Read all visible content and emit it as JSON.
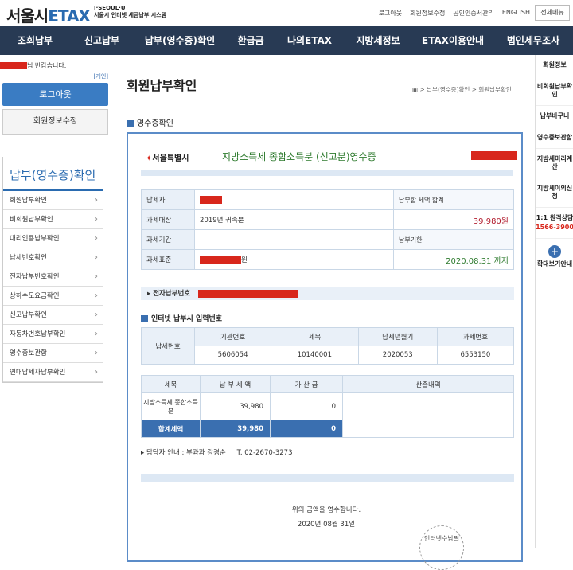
{
  "header": {
    "logo_ko": "서울시",
    "logo_en": "ETAX",
    "logo_sub1": "I·SEOUL·U",
    "logo_sub2": "서울시 인터넷 세금납부 시스템",
    "links": [
      "로그아웃",
      "회원정보수정",
      "공인인증서관리",
      "ENGLISH"
    ],
    "all_menu": "전체메뉴"
  },
  "gnb": [
    "조회납부",
    "신고납부",
    "납부(영수증)확인",
    "환급금",
    "나의ETAX",
    "지방세정보",
    "ETAX이용안내",
    "법인세무조사"
  ],
  "left": {
    "welcome": "님 반갑습니다.",
    "personal": "[개인]",
    "logout": "로그아웃",
    "edit_info": "회원정보수정",
    "menu_title": "납부(영수증)확인",
    "menu_items": [
      "회원납부확인",
      "비회원납부확인",
      "대리인용납부확인",
      "납세번호확인",
      "전자납부번호확인",
      "상하수도요금확인",
      "신고납부확인",
      "자동차번호납부확인",
      "영수증보관함",
      "연대납세자납부확인"
    ]
  },
  "main": {
    "page_title": "회원납부확인",
    "breadcrumb": "▣ > 납부(영수증)확인 > 회원납부확인",
    "section": "영수증확인"
  },
  "receipt": {
    "org": "서울특별시",
    "title": "지방소득세 종합소득분 (신고분)영수증",
    "taxpayer_label": "납세자",
    "target_label": "과세대상",
    "target_value": "2019년 귀속분",
    "period_label": "과세기간",
    "standard_label": "과세표준",
    "standard_unit": "원",
    "total_label": "납부할 세액 합계",
    "total_value": "39,980원",
    "due_label": "납부기한",
    "due_value": "2020.08.31 까지",
    "elec_label": "전자납부번호",
    "net_title": "인터넷 납부시 입력번호",
    "net_row_label": "납세번호",
    "net_headers": [
      "기관번호",
      "세목",
      "납세년월기",
      "과세번호"
    ],
    "net_values": [
      "5606054",
      "10140001",
      "2020053",
      "6553150"
    ],
    "pay_headers": [
      "세목",
      "납 부 세 액",
      "가 산 금",
      "산출내역"
    ],
    "pay_item": "지방소득세 종합소득분",
    "pay_amount": "39,980",
    "pay_add": "0",
    "total_row_label": "합계세액",
    "total_amount": "39,980",
    "total_add": "0",
    "contact": "담당자 안내 : 부과과 강경순",
    "phone": "T. 02-2670-3273",
    "received_text": "위의 금액을 영수합니다.",
    "received_date": "2020년 08월 31일",
    "stamp": "인터넷수납필"
  },
  "right": [
    "회원정보",
    "비회원납부확인",
    "납부바구니",
    "영수증보관함",
    "지방세미리계산",
    "지방세이의신청",
    "1:1 원격상담",
    "1566-3900",
    "확대보기안내"
  ],
  "colors": {
    "navy": "#283a54",
    "blue": "#3a7cc3",
    "redact": "#d8271c",
    "green": "#2d7a2d"
  }
}
